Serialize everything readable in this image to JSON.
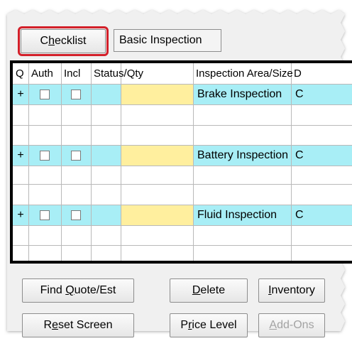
{
  "toolbar": {
    "checklist_label_pre": "C",
    "checklist_label_u": "h",
    "checklist_label_post": "ecklist",
    "checklist_value": "Basic Inspection"
  },
  "grid": {
    "headers": [
      "Q",
      "Auth",
      "Incl",
      "Status/Qty",
      "Inspection Area/Size",
      "D"
    ],
    "rows": [
      {
        "q": "+",
        "area": "Brake Inspection",
        "tail": "C"
      },
      {
        "q": "+",
        "area": "Battery Inspection",
        "tail": "C"
      },
      {
        "q": "+",
        "area": "Fluid Inspection",
        "tail": "C"
      }
    ]
  },
  "buttons": {
    "find_pre": "Find ",
    "find_u": "Q",
    "find_post": "uote/Est",
    "delete_u": "D",
    "delete_post": "elete",
    "inventory_u": "I",
    "inventory_post": "nventory",
    "reset_pre": "R",
    "reset_u": "e",
    "reset_post": "set Screen",
    "price_pre": "P",
    "price_u": "r",
    "price_post": "ice Level",
    "addons_u": "A",
    "addons_post": "dd-Ons"
  },
  "colors": {
    "highlight": "#d3202a",
    "row_cyan": "#a8eef6",
    "qty_yellow": "#ffef9e"
  }
}
